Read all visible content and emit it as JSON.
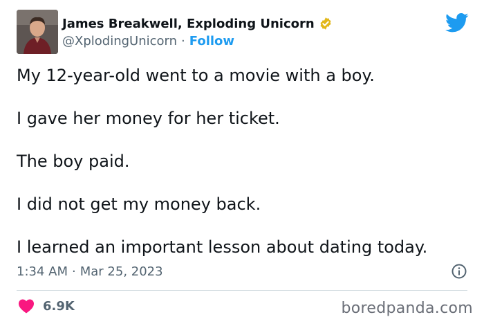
{
  "author": {
    "display_name": "James Breakwell, Exploding Unicorn",
    "handle": "@XplodingUnicorn",
    "separator": "·",
    "follow_label": "Follow",
    "verified": true,
    "avatar_icon": "avatar-photo"
  },
  "tweet": {
    "lines": [
      "My 12-year-old went to a movie with a boy.",
      "I gave her money for her ticket.",
      "The boy paid.",
      "I did not get my money back.",
      "I learned an important lesson about dating today."
    ],
    "time": "1:34 AM",
    "date": "Mar 25, 2023",
    "separator": "·"
  },
  "engagement": {
    "likes": "6.9K"
  },
  "watermark": "boredpanda.com",
  "colors": {
    "accent": "#1d9bf0",
    "heart": "#f91880",
    "secondary_text": "#536471",
    "verified_badge": "#e2b719"
  },
  "icons": {
    "logo": "twitter-bird-icon",
    "verified": "verified-badge-icon",
    "info": "info-icon",
    "like": "heart-icon"
  }
}
